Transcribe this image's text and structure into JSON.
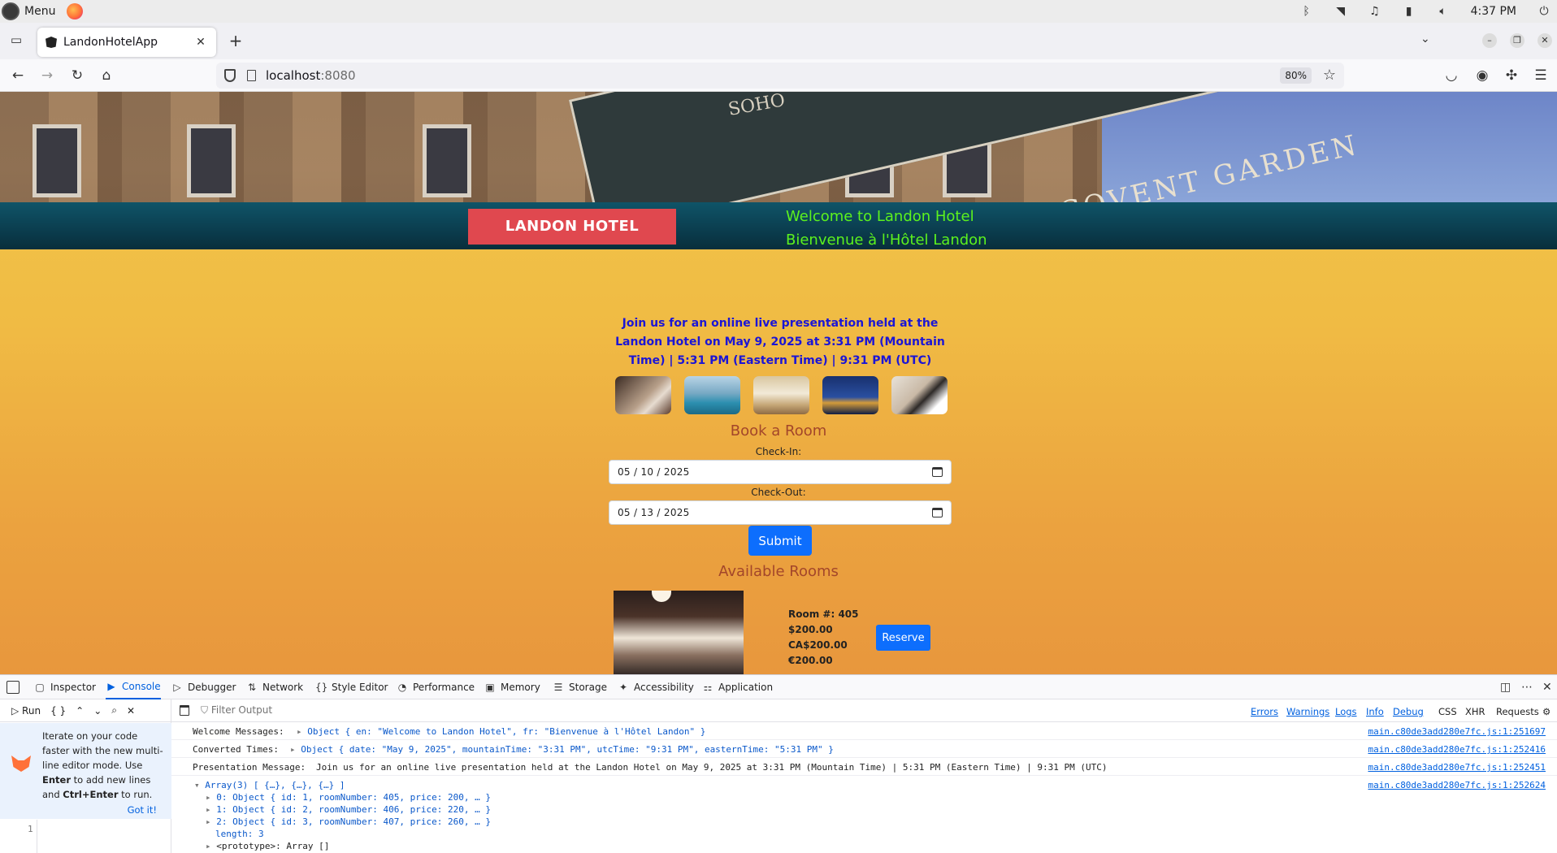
{
  "os": {
    "menu_label": "Menu",
    "clock": "4:37 PM"
  },
  "browser": {
    "tab_title": "LandonHotelApp",
    "url_host": "localhost",
    "url_port": ":8080",
    "zoom": "80%"
  },
  "page": {
    "brand": "LANDON HOTEL",
    "welcome_en": "Welcome to Landon Hotel",
    "welcome_fr": "Bienvenue à l'Hôtel Landon",
    "presentation": "Join us for an online live presentation held at the Landon Hotel on May 9, 2025 at 3:31 PM (Mountain Time) | 5:31 PM (Eastern Time) | 9:31 PM (UTC)",
    "book_title": "Book a Room",
    "checkin_label": "Check-In:",
    "checkin_value": "05 / 10 / 2025",
    "checkout_label": "Check-Out:",
    "checkout_value": "05 / 13 / 2025",
    "submit_label": "Submit",
    "available_title": "Available Rooms",
    "room": {
      "number": "Room #: 405",
      "price_usd": "$200.00",
      "price_cad": "CA$200.00",
      "price_eur": "€200.00",
      "reserve_label": "Reserve"
    }
  },
  "devtools": {
    "tabs": [
      "Inspector",
      "Console",
      "Debugger",
      "Network",
      "Style Editor",
      "Performance",
      "Memory",
      "Storage",
      "Accessibility",
      "Application"
    ],
    "run_label": "Run",
    "braces": "{ }",
    "filter_placeholder": "Filter Output",
    "levels": [
      "Errors",
      "Warnings",
      "Logs",
      "Info",
      "Debug"
    ],
    "extra_filters": [
      "CSS",
      "XHR",
      "Requests"
    ],
    "tip": {
      "text_1": "Iterate on your code faster with the new multi-line editor mode. Use ",
      "enter": "Enter",
      "text_2": " to add new lines and ",
      "ctrl_enter": "Ctrl+Enter",
      "text_3": " to run.",
      "got_it": "Got it!"
    },
    "line_number": "1",
    "console": {
      "welcome_label": "Welcome Messages:",
      "welcome_value": "Object { en: \"Welcome to Landon Hotel\", fr: \"Bienvenue à l'Hôtel Landon\" }",
      "welcome_src": "main.c80de3add280e7fc.js:1:251697",
      "times_label": "Converted Times:",
      "times_value": "Object { date: \"May 9, 2025\", mountainTime: \"3:31 PM\", utcTime: \"9:31 PM\", easternTime: \"5:31 PM\" }",
      "times_src": "main.c80de3add280e7fc.js:1:252416",
      "presentation_label": "Presentation Message:",
      "presentation_value": "Join us for an online live presentation held at the Landon Hotel on May 9, 2025 at 3:31 PM (Mountain Time) | 5:31 PM (Eastern Time) | 9:31 PM (UTC)",
      "presentation_src": "main.c80de3add280e7fc.js:1:252451",
      "array_header": "Array(3) [ {…}, {…}, {…} ]",
      "array_src": "main.c80de3add280e7fc.js:1:252624",
      "array_items": [
        "0: Object { id: 1, roomNumber: 405, price: 200, … }",
        "1: Object { id: 2, roomNumber: 406, price: 220, … }",
        "2: Object { id: 3, roomNumber: 407, price: 260, … }"
      ],
      "array_length": "length: 3",
      "array_proto": "<prototype>: Array []"
    }
  }
}
